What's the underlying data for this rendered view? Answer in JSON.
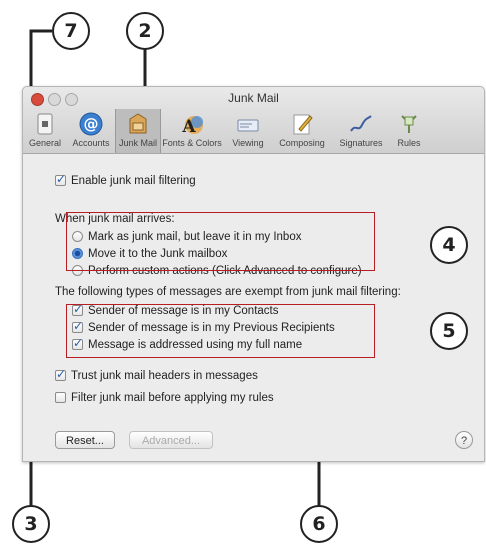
{
  "window": {
    "title": "Junk Mail",
    "toolbar": [
      {
        "label": "General",
        "icon": "general-icon"
      },
      {
        "label": "Accounts",
        "icon": "accounts-icon"
      },
      {
        "label": "Junk Mail",
        "icon": "junk-mail-icon",
        "selected": true
      },
      {
        "label": "Fonts & Colors",
        "icon": "fonts-colors-icon"
      },
      {
        "label": "Viewing",
        "icon": "viewing-icon"
      },
      {
        "label": "Composing",
        "icon": "composing-icon"
      },
      {
        "label": "Signatures",
        "icon": "signatures-icon"
      },
      {
        "label": "Rules",
        "icon": "rules-icon"
      }
    ]
  },
  "junk": {
    "enable_label": "Enable junk mail filtering",
    "enable_checked": true,
    "when_arrives_label": "When junk mail arrives:",
    "options": [
      {
        "label": "Mark as junk mail, but leave it in my Inbox",
        "selected": false
      },
      {
        "label": "Move it to the Junk mailbox",
        "selected": true
      },
      {
        "label": "Perform custom actions (Click Advanced to configure)",
        "selected": false
      }
    ],
    "exempt_label": "The following types of messages are exempt from junk mail filtering:",
    "exempt_items": [
      {
        "label": "Sender of message is in my Contacts",
        "checked": true
      },
      {
        "label": "Sender of message is in my Previous Recipients",
        "checked": true
      },
      {
        "label": "Message is addressed using my full name",
        "checked": true
      }
    ],
    "trust_label": "Trust junk mail headers in messages",
    "trust_checked": true,
    "filter_before_label": "Filter junk mail before applying my rules",
    "filter_before_checked": false,
    "reset_button": "Reset...",
    "advanced_button": "Advanced...",
    "help_symbol": "?"
  },
  "callouts": [
    "7",
    "2",
    "4",
    "5",
    "3",
    "6"
  ],
  "colors": {
    "callout_box": "#b51f24",
    "leader_line": "#222222",
    "selected_tab": "#bdbdbd"
  }
}
